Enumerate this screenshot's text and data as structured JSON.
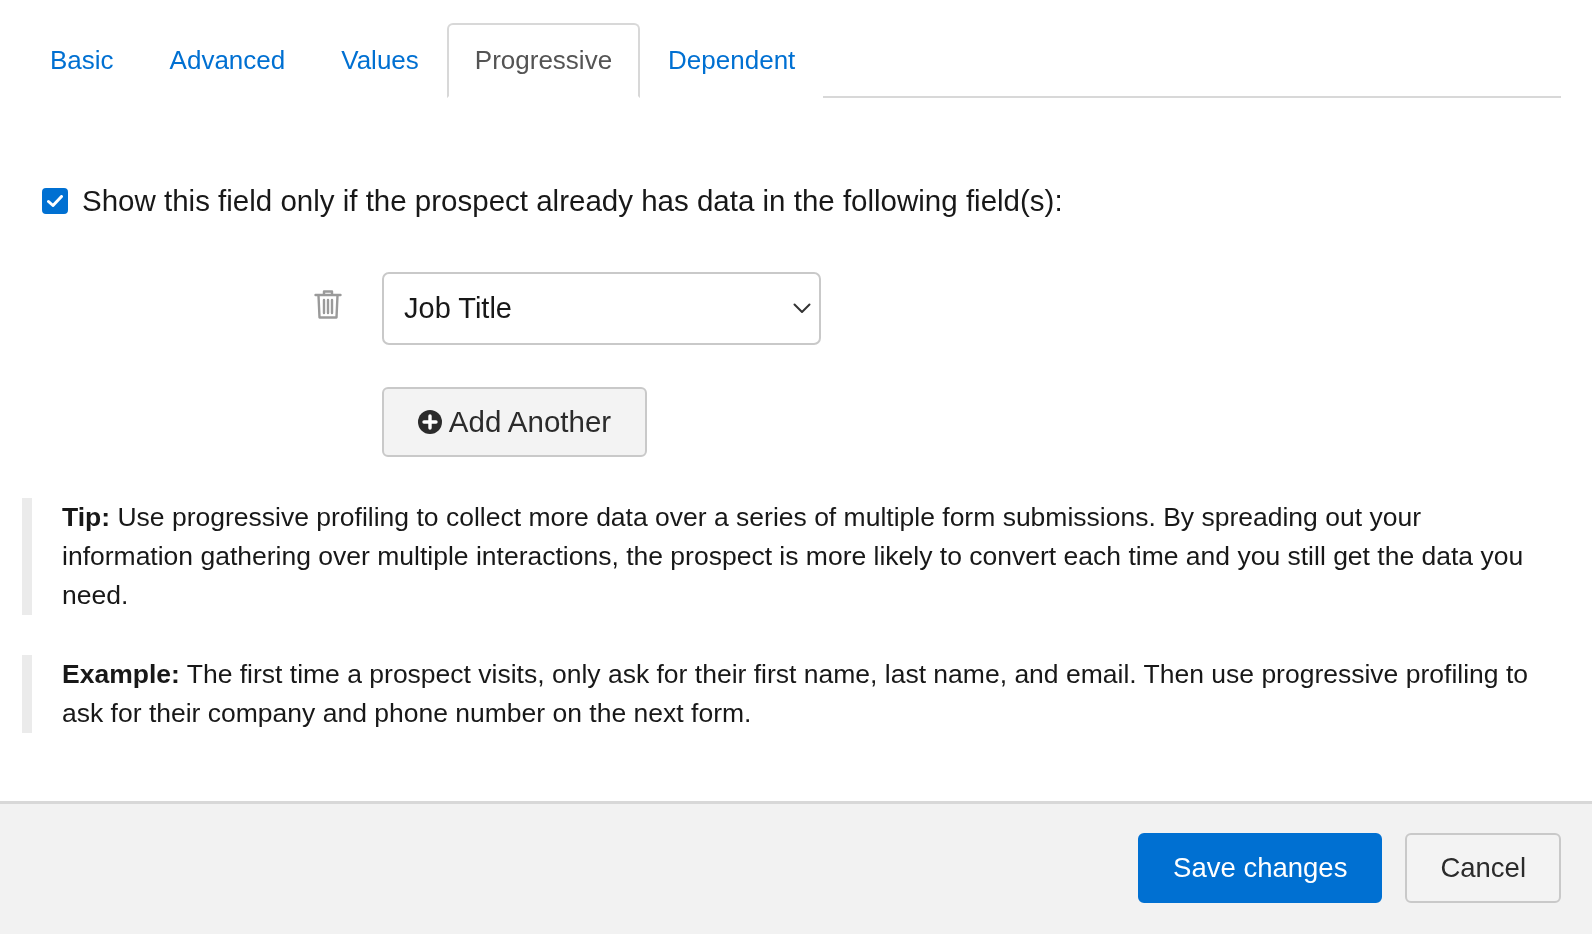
{
  "tabs": [
    {
      "label": "Basic",
      "selected": false
    },
    {
      "label": "Advanced",
      "selected": false
    },
    {
      "label": "Values",
      "selected": false
    },
    {
      "label": "Progressive",
      "selected": true
    },
    {
      "label": "Dependent",
      "selected": false
    }
  ],
  "condition": {
    "checked": true,
    "label": "Show this field only if the prospect already has data in the following field(s):"
  },
  "fields": [
    {
      "value": "Job Title"
    }
  ],
  "add_button": {
    "label": "Add Another"
  },
  "notes": [
    {
      "text": "**Tip:** Use progressive profiling to collect more data over a series of multiple form submissions. By spreading out your information gathering over multiple interactions, the prospect is more likely to convert each time and you still get the data you need."
    },
    {
      "text": "**Example:** The first time a prospect visits, only ask for their first name, last name, and email. Then use progressive profiling to ask for their company and phone number on the next form."
    }
  ],
  "footer": {
    "buttons": [
      {
        "label": "Save changes",
        "kind": "primary"
      },
      {
        "label": "Cancel",
        "kind": "secondary"
      }
    ]
  }
}
